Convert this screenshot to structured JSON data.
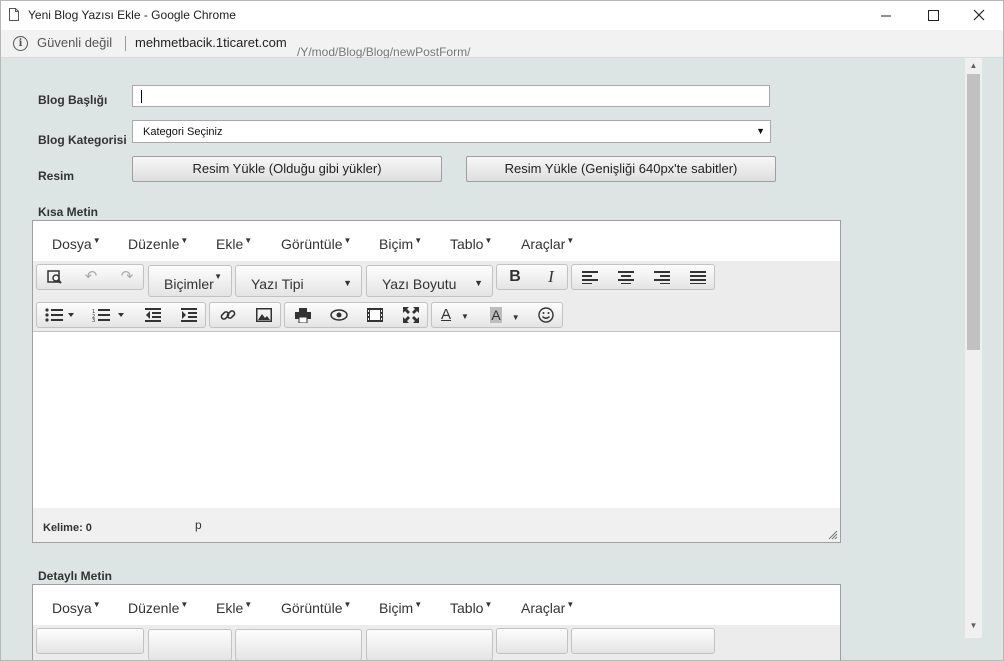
{
  "window": {
    "title": "Yeni Blog Yazısı Ekle - Google Chrome",
    "minimize_icon": "minimize-icon",
    "maximize_icon": "maximize-icon",
    "close_icon": "close-icon"
  },
  "address_bar": {
    "security_label": "Güvenli değil",
    "url_host": "mehmetbacik.1ticaret.com",
    "url_path": "/Y/mod/Blog/Blog/newPostForm/"
  },
  "form": {
    "title_label": "Blog Başlığı",
    "title_value": "",
    "category_label": "Blog Kategorisi",
    "category_selected": "Kategori Seçiniz",
    "image_label": "Resim",
    "upload_as_is": "Resim Yükle (Olduğu gibi yükler)",
    "upload_fixed_width": "Resim Yükle (Genişliği 640px'te sabitler)",
    "short_text_label": "Kısa Metin",
    "detail_text_label": "Detaylı Metin"
  },
  "editor": {
    "menus": [
      "Dosya",
      "Düzenle",
      "Ekle",
      "Görüntüle",
      "Biçim",
      "Tablo",
      "Araçlar"
    ],
    "formats_label": "Biçimler",
    "font_family_label": "Yazı Tipi",
    "font_size_label": "Yazı Boyutu",
    "bold_glyph": "B",
    "italic_glyph": "I",
    "text_color_glyph": "A",
    "bg_color_glyph": "A",
    "word_count": "Kelime: 0",
    "element_path": "p"
  },
  "colors": {
    "page_background": "#dde5e4",
    "toolbar_background": "#ececec",
    "scrollbar_thumb": "#c1c1c1"
  }
}
